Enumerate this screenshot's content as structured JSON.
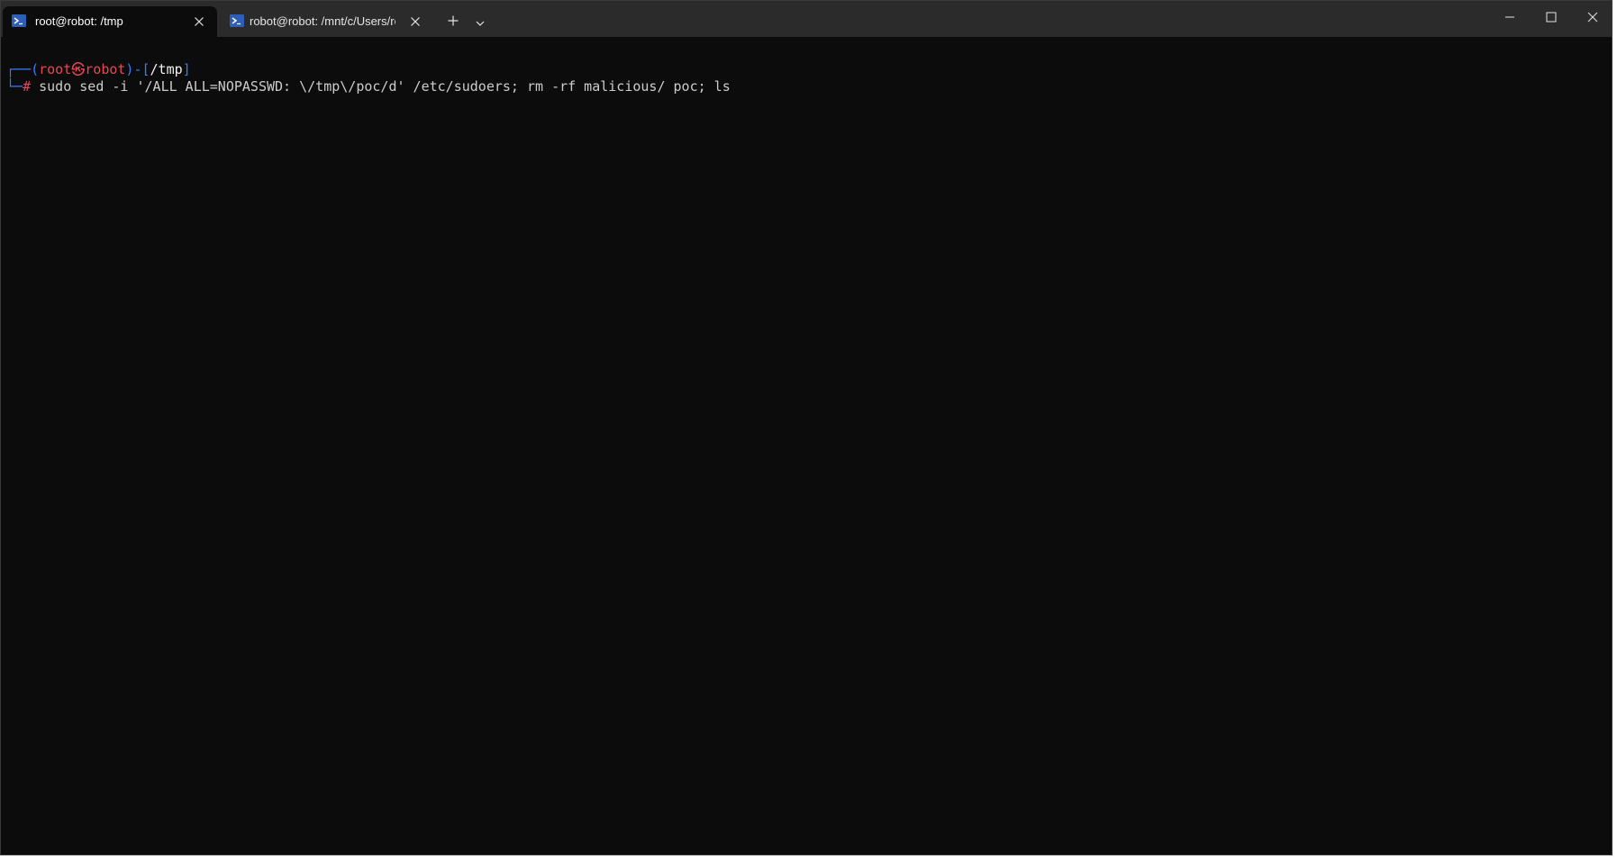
{
  "tabs": [
    {
      "title": "root@robot: /tmp",
      "active": true,
      "icon": "terminal-icon"
    },
    {
      "title": "robot@robot: /mnt/c/Users/ro",
      "active": false,
      "icon": "terminal-icon"
    }
  ],
  "titlebar": {
    "new_tab_icon": "plus-icon",
    "dropdown_icon": "chevron-down-icon",
    "minimize_icon": "minimize-icon",
    "maximize_icon": "maximize-icon",
    "close_icon": "close-icon"
  },
  "terminal": {
    "prompt": {
      "corner_top": "┌──",
      "open_paren": "(",
      "user": "root",
      "at_symbol": "㉿",
      "host": "robot",
      "close_paren": ")",
      "dash": "-",
      "open_bracket": "[",
      "path": "/tmp",
      "close_bracket": "]",
      "corner_bottom": "└─",
      "hash": "#"
    },
    "command": "sudo sed -i '/ALL ALL=NOPASSWD: \\/tmp\\/poc/d' /etc/sudoers; rm -rf malicious/ poc; ls"
  },
  "colors": {
    "terminal_bg": "#0c0c0c",
    "titlebar_bg": "#2b2b2b",
    "prompt_blue": "#3b78ff",
    "prompt_red": "#e74856",
    "text": "#cccccc"
  }
}
